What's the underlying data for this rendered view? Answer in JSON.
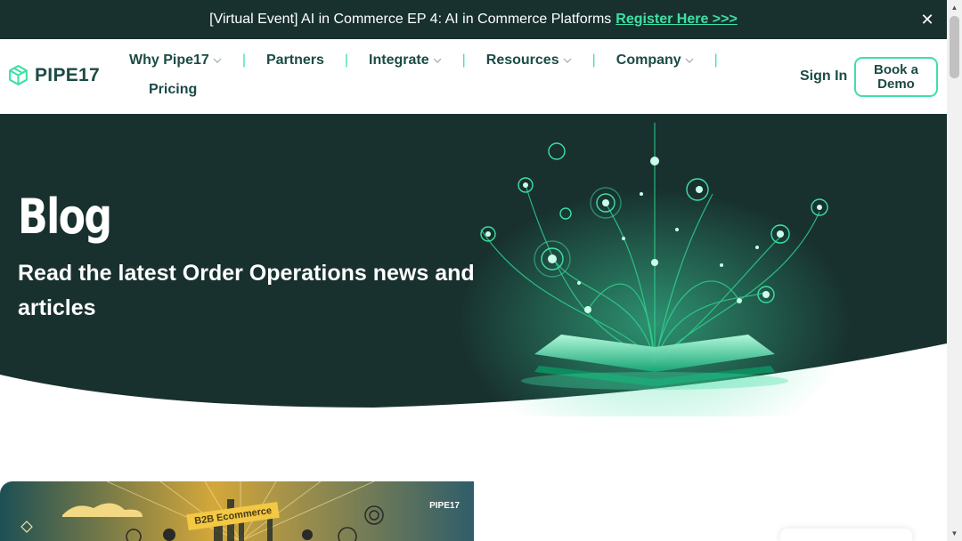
{
  "announcement": {
    "text": "[Virtual Event] AI in Commerce EP 4: AI in Commerce Platforms",
    "link_label": "Register Here >>>",
    "close_icon": "close-icon"
  },
  "nav": {
    "logo_text": "PIPE17",
    "items": [
      {
        "label": "Why Pipe17",
        "has_dropdown": true
      },
      {
        "label": "Partners",
        "has_dropdown": false
      },
      {
        "label": "Integrate",
        "has_dropdown": true
      },
      {
        "label": "Resources",
        "has_dropdown": true
      },
      {
        "label": "Company",
        "has_dropdown": true
      }
    ],
    "pricing_label": "Pricing",
    "signin_label": "Sign In",
    "demo_label_line1": "Book a",
    "demo_label_line2": "Demo"
  },
  "hero": {
    "title": "Blog",
    "subtitle": "Read the latest Order Operations news and articles"
  },
  "featured_card": {
    "badge": "B2B Ecommerce",
    "brand": "PIPE17"
  },
  "colors": {
    "dark_teal": "#18312f",
    "accent_green": "#3ee0a5",
    "nav_text": "#1b4b46"
  }
}
